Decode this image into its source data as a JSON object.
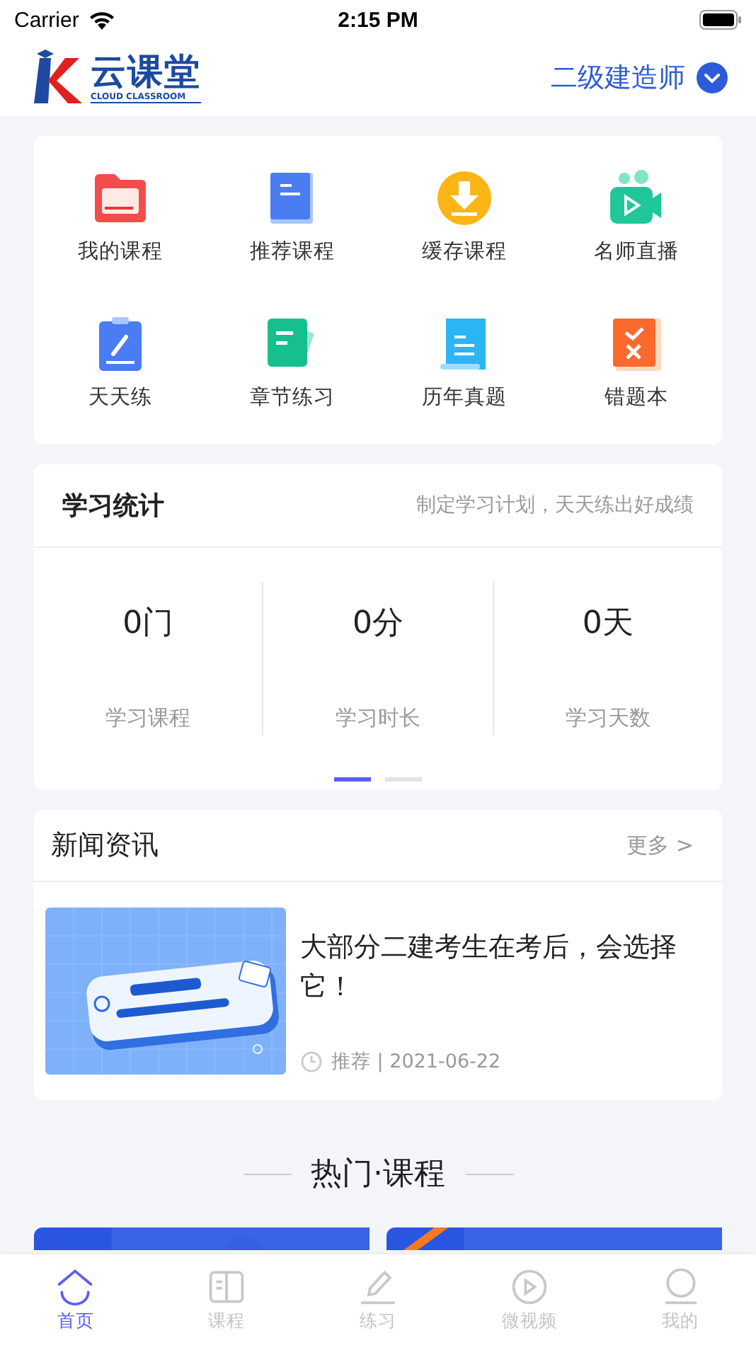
{
  "status_bar": {
    "carrier": "Carrier",
    "time": "2:15 PM"
  },
  "header": {
    "logo_text": "云课堂",
    "logo_subtitle": "CLOUD CLASSROOM",
    "exam_selector": "二级建造师"
  },
  "shortcuts": [
    {
      "label": "我的课程"
    },
    {
      "label": "推荐课程"
    },
    {
      "label": "缓存课程"
    },
    {
      "label": "名师直播"
    },
    {
      "label": "天天练"
    },
    {
      "label": "章节练习"
    },
    {
      "label": "历年真题"
    },
    {
      "label": "错题本"
    }
  ],
  "study_stats": {
    "title": "学习统计",
    "subtitle": "制定学习计划，天天练出好成绩",
    "stats": [
      {
        "value": "0门",
        "label": "学习课程"
      },
      {
        "value": "0分",
        "label": "学习时长"
      },
      {
        "value": "0天",
        "label": "学习天数"
      }
    ],
    "pager": [
      {
        "selected": true
      },
      {
        "selected": false
      }
    ]
  },
  "news": {
    "title": "新闻资讯",
    "more": "更多 >",
    "articles": [
      {
        "kind": "picture",
        "headline": "大部分二建考生在考后，会选择它！",
        "meta": "推荐 | 2021-06-22"
      }
    ]
  },
  "hot_courses": {
    "title": "热门·课程"
  },
  "tab_bar": [
    {
      "label": "首页",
      "selected": true
    },
    {
      "label": "课程",
      "selected": false
    },
    {
      "label": "练习",
      "selected": false
    },
    {
      "label": "微视频",
      "selected": false
    },
    {
      "label": "我的",
      "selected": false
    }
  ]
}
